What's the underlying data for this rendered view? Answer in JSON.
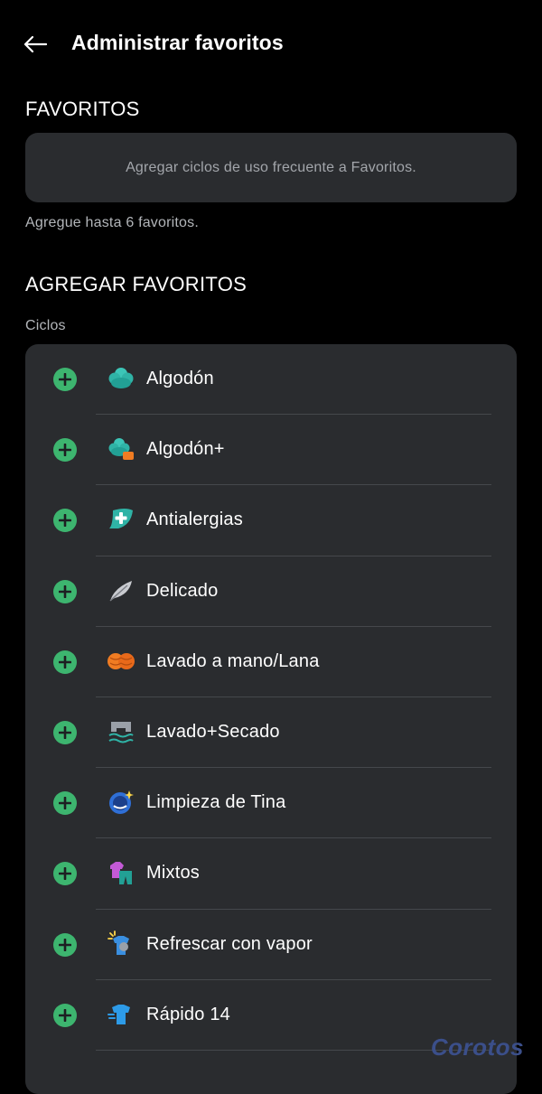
{
  "header": {
    "title": "Administrar favoritos"
  },
  "favorites": {
    "heading": "FAVORITOS",
    "empty_text": "Agregar ciclos de uso frecuente a Favoritos.",
    "hint": "Agregue hasta 6 favoritos."
  },
  "add_favorites": {
    "heading": "AGREGAR FAVORITOS",
    "sublabel": "Ciclos",
    "items": [
      {
        "label": "Algodón",
        "icon": "cotton-icon"
      },
      {
        "label": "Algodón+",
        "icon": "cotton-plus-icon"
      },
      {
        "label": "Antialergias",
        "icon": "allergy-care-icon"
      },
      {
        "label": "Delicado",
        "icon": "feather-icon"
      },
      {
        "label": "Lavado a mano/Lana",
        "icon": "wool-icon"
      },
      {
        "label": "Lavado+Secado",
        "icon": "wash-dry-icon"
      },
      {
        "label": "Limpieza de Tina",
        "icon": "tub-clean-icon"
      },
      {
        "label": "Mixtos",
        "icon": "mixed-clothes-icon"
      },
      {
        "label": "Refrescar con vapor",
        "icon": "steam-refresh-icon"
      },
      {
        "label": "Rápido 14",
        "icon": "quick-shirt-icon"
      }
    ]
  },
  "watermark": "Corotos",
  "colors": {
    "background": "#000000",
    "card": "#2a2c2f",
    "accent_green": "#3db56f",
    "divider": "#45484c"
  }
}
